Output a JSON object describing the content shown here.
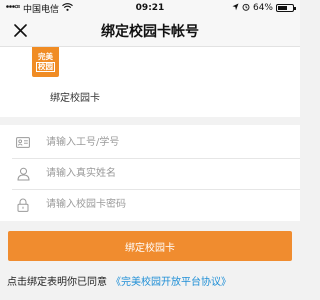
{
  "status_bar": {
    "carrier": "中国电信",
    "time": "09:21",
    "battery": "64%",
    "battery_level": 0.64
  },
  "nav": {
    "title": "绑定校园卡帐号"
  },
  "header": {
    "logo_line1": "完美",
    "logo_line2": "校园",
    "label": "绑定校园卡"
  },
  "form": {
    "id_placeholder": "请输入工号/学号",
    "name_placeholder": "请输入真实姓名",
    "password_placeholder": "请输入校园卡密码"
  },
  "bind_button": "绑定校园卡",
  "agreement": {
    "text": "点击绑定表明你已同意",
    "link": "《完美校园开放平台协议》"
  },
  "colors": {
    "accent": "#f08c2f",
    "link": "#1f8fd6"
  },
  "icons": [
    "signal-icon",
    "wifi-icon",
    "location-icon",
    "alarm-icon",
    "battery-icon",
    "close-icon",
    "id-card-icon",
    "user-icon",
    "lock-icon"
  ]
}
